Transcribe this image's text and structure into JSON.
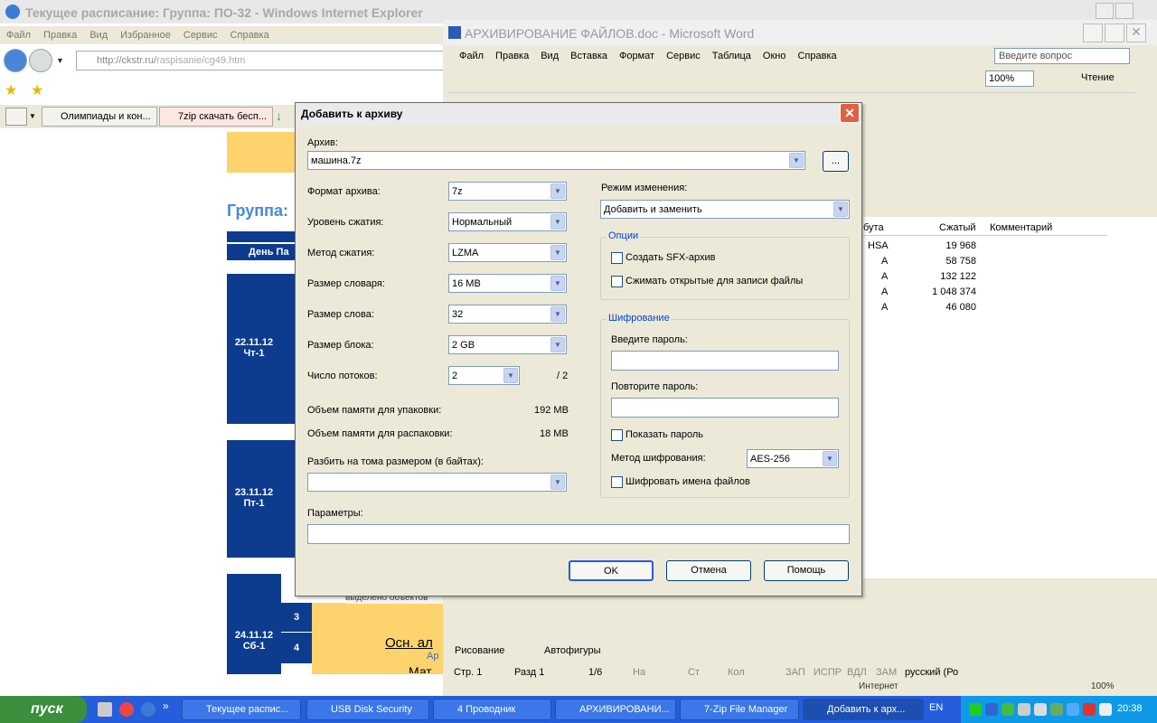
{
  "ie": {
    "title": "Текущее расписание: Группа: ПО-32 - Windows Internet Explorer",
    "menu": [
      "Файл",
      "Правка",
      "Вид",
      "Избранное",
      "Сервис",
      "Справка"
    ],
    "address_prefix": "http://ckstr.ru/",
    "address_path": "raspisanie/cg49.htm",
    "tabs": [
      "Олимпиады и кон...",
      "7zip скачать бесп..."
    ],
    "heading": "Группа:",
    "sched_header": "День Па",
    "days": [
      {
        "date": "22.11.12",
        "day": "Чт-1"
      },
      {
        "date": "23.11.12",
        "day": "Пт-1"
      },
      {
        "date": "24.11.12",
        "day": "Сб-1"
      }
    ],
    "pairs": [
      "3",
      "4"
    ],
    "row4_text": "Осн. ал",
    "row4_sub": "Ар",
    "row4_more": "Мат",
    "behind_text": "выделено объектов"
  },
  "word": {
    "title": "АРХИВИРОВАНИЕ ФАЙЛОВ.doc - Microsoft Word",
    "menu": [
      "Файл",
      "Правка",
      "Вид",
      "Вставка",
      "Формат",
      "Сервис",
      "Таблица",
      "Окно",
      "Справка"
    ],
    "ask_placeholder": "Введите вопрос",
    "zoom": "100%",
    "reading": "Чтение",
    "draw_label": "Рисование",
    "autoshapes": "Автофигуры",
    "status": {
      "page": "Стр. 1",
      "section": "Разд 1",
      "pages": "1/6",
      "at": "На",
      "line": "Ст",
      "col": "Кол",
      "rec": "ЗАП",
      "trk": "ИСПР",
      "ext": "ВДЛ",
      "ovr": "ЗАМ",
      "lang": "русский (Ро"
    }
  },
  "filemanager": {
    "columns": [
      "бута",
      "Сжатый",
      "Комментарий"
    ],
    "rows": [
      {
        "attr": "HSA",
        "size": "19 968"
      },
      {
        "attr": "A",
        "size": "58 758"
      },
      {
        "attr": "A",
        "size": "132 122"
      },
      {
        "attr": "A",
        "size": "1 048 374"
      },
      {
        "attr": "A",
        "size": "46 080"
      }
    ],
    "status_internet": "Интернет",
    "status_zoom": "100%"
  },
  "dialog": {
    "title": "Добавить к архиву",
    "archive_label": "Архив:",
    "archive_value": "машина.7z",
    "browse": "...",
    "format_label": "Формат архива:",
    "format_value": "7z",
    "level_label": "Уровень сжатия:",
    "level_value": "Нормальный",
    "method_label": "Метод сжатия:",
    "method_value": "LZMA",
    "dict_label": "Размер словаря:",
    "dict_value": "16 MB",
    "word_label": "Размер слова:",
    "word_value": "32",
    "block_label": "Размер блока:",
    "block_value": "2 GB",
    "threads_label": "Число потоков:",
    "threads_value": "2",
    "threads_max": "/ 2",
    "mem_pack_label": "Объем памяти для упаковки:",
    "mem_pack_value": "192 MB",
    "mem_unpack_label": "Объем памяти для распаковки:",
    "mem_unpack_value": "18 MB",
    "split_label": "Разбить на тома размером (в байтах):",
    "split_value": "",
    "params_label": "Параметры:",
    "params_value": "",
    "update_label": "Режим изменения:",
    "update_value": "Добавить и заменить",
    "options_title": "Опции",
    "sfx_label": "Создать SFX-архив",
    "shared_label": "Сжимать открытые для записи файлы",
    "enc_title": "Шифрование",
    "pass_label": "Введите пароль:",
    "repass_label": "Повторите пароль:",
    "show_pass_label": "Показать пароль",
    "enc_method_label": "Метод шифрования:",
    "enc_method_value": "AES-256",
    "enc_names_label": "Шифровать имена файлов",
    "ok": "OK",
    "cancel": "Отмена",
    "help": "Помощь"
  },
  "taskbar": {
    "start": "пуск",
    "items": [
      "Текущее распис...",
      "USB Disk Security",
      "4 Проводник",
      "АРХИВИРОВАНИ...",
      "7-Zip File Manager",
      "Добавить к арх..."
    ],
    "lang": "EN",
    "clock": "20:38"
  }
}
